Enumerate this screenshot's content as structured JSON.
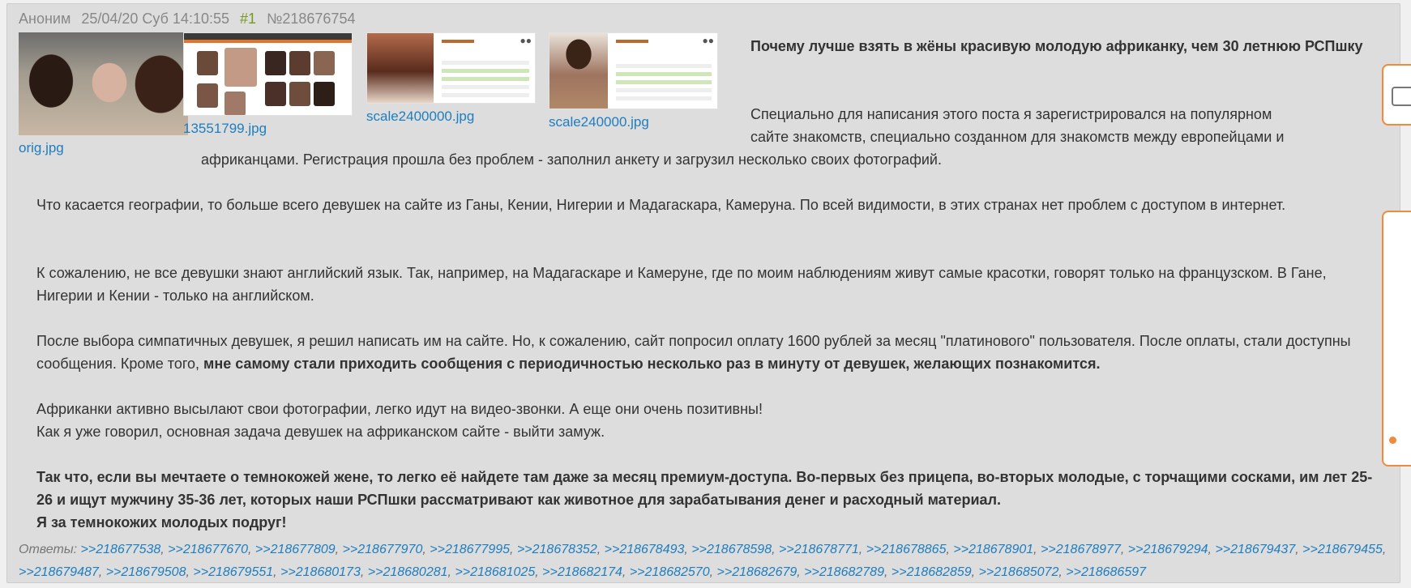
{
  "header": {
    "author": "Аноним",
    "datetime": "25/04/20 Суб 14:10:55",
    "ordinal": "#1",
    "post_number": "№218676754"
  },
  "attachments": [
    {
      "filename": "orig.jpg"
    },
    {
      "filename": "13551799.jpg"
    },
    {
      "filename": "scale2400000.jpg"
    },
    {
      "filename": "scale240000.jpg"
    }
  ],
  "post": {
    "title": "Почему лучше взять в жёны красивую молодую африканку, чем 30 летнюю РСПшку",
    "p1_line1": "Специально для написания этого поста я зарегистрировался на популярном",
    "p1_line2": "сайте знакомств, специально созданном для знакомств между европейцами и",
    "p1_line3": "африканцами. Регистрация прошла без проблем - заполнил анкету и загрузил несколько своих фотографий.",
    "p2": "Что касается географии, то больше всего девушек на сайте из Ганы, Кении, Нигерии и Мадагаскара, Камеруна. По всей видимости, в этих странах нет проблем с доступом в интернет.",
    "p3": "К сожалению, не все девушки знают английский язык. Так, например, на Мадагаскаре и Камеруне, где по моим наблюдениям живут самые красотки, говорят только на французском. В Гане, Нигерии и Кении - только на английском.",
    "p4_plain": "После выбора симпатичных девушек, я решил написать им на сайте. Но, к сожалению, сайт попросил оплату 1600 рублей за месяц \"платинового\" пользователя. После оплаты, стали доступны сообщения. Кроме того, ",
    "p4_bold": "мне самому стали приходить сообщения с периодичностью несколько раз в минуту от девушек, желающих познакомится.",
    "p5_line1": "Африканки активно высылают свои фотографии, легко идут на видео-звонки. А еще они очень позитивны!",
    "p5_line2": "Как я уже говорил, основная задача девушек на африканском сайте - выйти замуж.",
    "p6_bold": "Так что, если вы мечтаете о темнокожей жене, то легко её найдете там даже за месяц премиум-доступа. Во-первых без прицепа, во-вторых молодые, с торчащими сосками, им лет 25-26 и ищут мужчину 35-36 лет, которых наши РСПшки рассматривают как животное для зарабатывания денег и расходный материал.",
    "p7_bold": "Я за темнокожих молодых подруг!"
  },
  "replies": {
    "label": "Ответы:",
    "links": [
      ">>218677538",
      ">>218677670",
      ">>218677809",
      ">>218677970",
      ">>218677995",
      ">>218678352",
      ">>218678493",
      ">>218678598",
      ">>218678771",
      ">>218678865",
      ">>218678901",
      ">>218678977",
      ">>218679294",
      ">>218679437",
      ">>218679455",
      ">>218679487",
      ">>218679508",
      ">>218679551",
      ">>218680173",
      ">>218680281",
      ">>218681025",
      ">>218682174",
      ">>218682570",
      ">>218682679",
      ">>218682789",
      ">>218682859",
      ">>218685072",
      ">>218686597"
    ]
  },
  "colors": {
    "post_bg": "#dddddd",
    "link": "#1e7ebf",
    "ordinal": "#789922",
    "meta": "#888888",
    "accent": "#f08a3c"
  },
  "icons": {
    "side_tab_top": "chat-bubble-icon",
    "side_tab_bottom": "orange-dot-icon"
  }
}
